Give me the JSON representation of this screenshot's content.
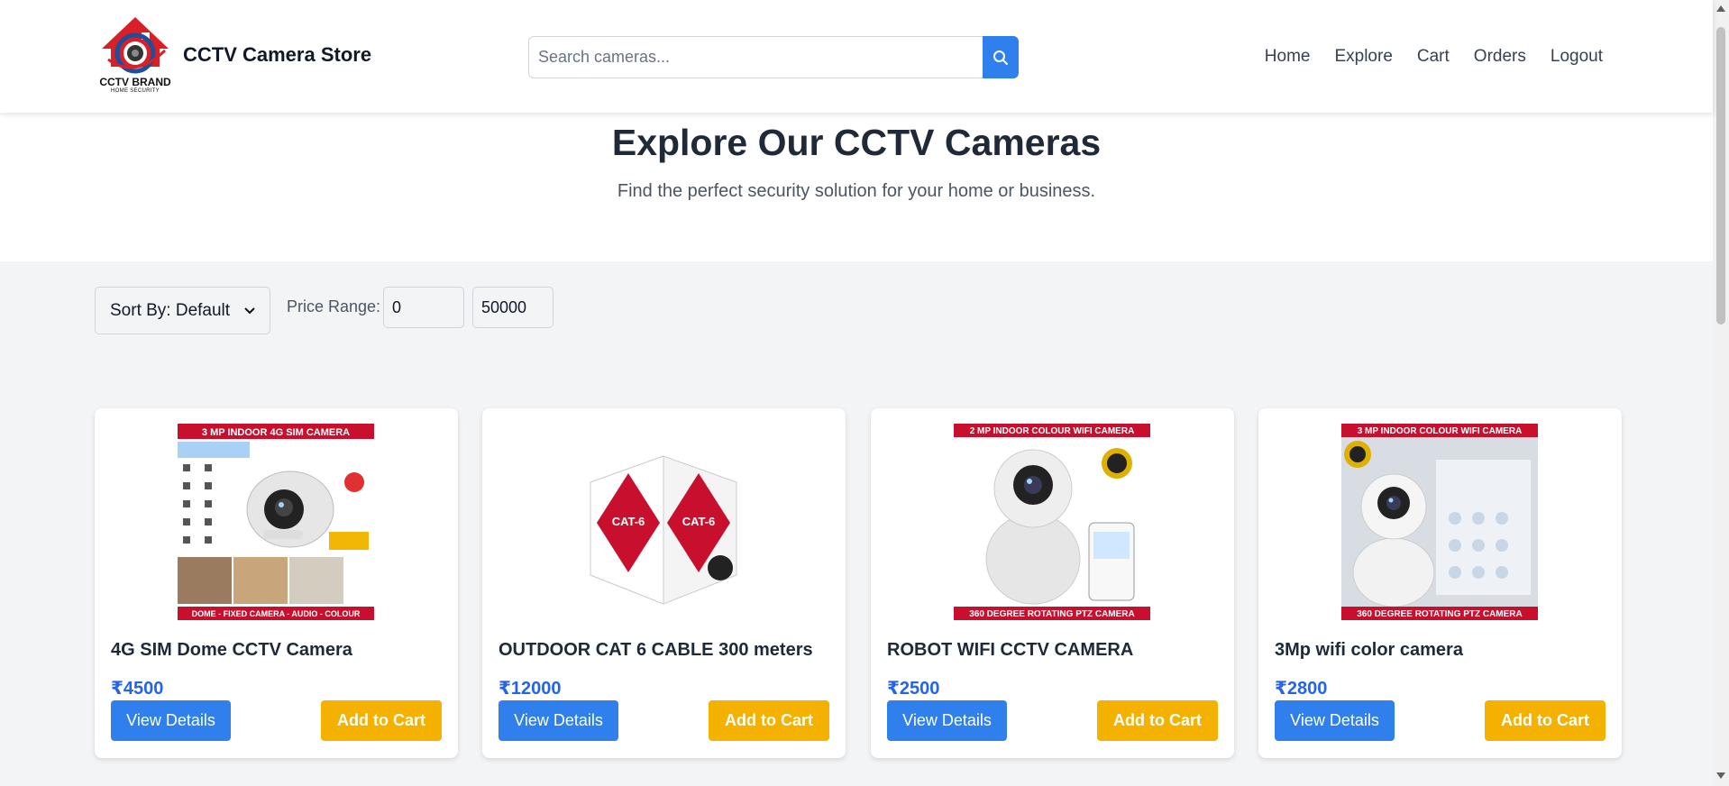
{
  "header": {
    "logo_text": "CCTV BRAND",
    "logo_subtext": "HOME SECURITY",
    "store_name": "CCTV Camera Store",
    "search_placeholder": "Search cameras...",
    "nav": [
      "Home",
      "Explore",
      "Cart",
      "Orders",
      "Logout"
    ]
  },
  "hero": {
    "title": "Explore Our CCTV Cameras",
    "subtitle": "Find the perfect security solution for your home or business."
  },
  "filters": {
    "sort_value": "Sort By: Default",
    "price_label": "Price Range:",
    "price_min": "0",
    "price_max": "50000"
  },
  "products": [
    {
      "name": "4G SIM Dome CCTV Camera",
      "price": "₹4500",
      "image_banner_top": "3 MP INDOOR 4G SIM CAMERA",
      "image_banner_bottom": "DOME - FIXED CAMERA - AUDIO - COLOUR",
      "view_label": "View Details",
      "cart_label": "Add to Cart"
    },
    {
      "name": "OUTDOOR CAT 6 CABLE 300 meters",
      "price": "₹12000",
      "image_banner_top": "",
      "image_banner_bottom": "",
      "view_label": "View Details",
      "cart_label": "Add to Cart"
    },
    {
      "name": "ROBOT WIFI CCTV CAMERA",
      "price": "₹2500",
      "image_banner_top": "2 MP INDOOR COLOUR WIFI CAMERA",
      "image_banner_bottom": "360 DEGREE ROTATING PTZ CAMERA",
      "view_label": "View Details",
      "cart_label": "Add to Cart"
    },
    {
      "name": "3Mp wifi color camera",
      "price": "₹2800",
      "image_banner_top": "3 MP INDOOR COLOUR WIFI CAMERA",
      "image_banner_bottom": "360 DEGREE ROTATING PTZ CAMERA",
      "view_label": "View Details",
      "cart_label": "Add to Cart"
    }
  ],
  "colors": {
    "primary_blue": "#2f80ed",
    "cart_yellow": "#f5b100",
    "price_blue": "#2563eb",
    "banner_red": "#c8102e"
  }
}
